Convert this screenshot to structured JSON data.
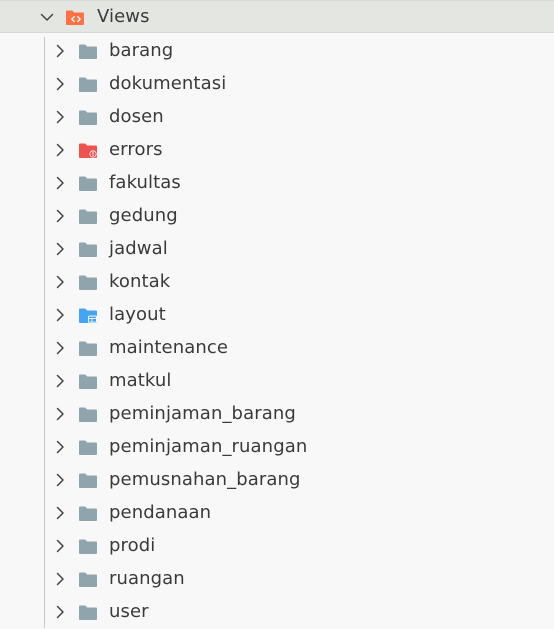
{
  "explorer": {
    "root": {
      "label": "Views",
      "icon": "views-folder-icon",
      "expanded": true
    },
    "children": [
      {
        "label": "barang",
        "icon": "folder-icon"
      },
      {
        "label": "dokumentasi",
        "icon": "folder-icon"
      },
      {
        "label": "dosen",
        "icon": "folder-icon"
      },
      {
        "label": "errors",
        "icon": "errors-folder-icon"
      },
      {
        "label": "fakultas",
        "icon": "folder-icon"
      },
      {
        "label": "gedung",
        "icon": "folder-icon"
      },
      {
        "label": "jadwal",
        "icon": "folder-icon"
      },
      {
        "label": "kontak",
        "icon": "folder-icon"
      },
      {
        "label": "layout",
        "icon": "layout-folder-icon"
      },
      {
        "label": "maintenance",
        "icon": "folder-icon"
      },
      {
        "label": "matkul",
        "icon": "folder-icon"
      },
      {
        "label": "peminjaman_barang",
        "icon": "folder-icon"
      },
      {
        "label": "peminjaman_ruangan",
        "icon": "folder-icon"
      },
      {
        "label": "pemusnahan_barang",
        "icon": "folder-icon"
      },
      {
        "label": "pendanaan",
        "icon": "folder-icon"
      },
      {
        "label": "prodi",
        "icon": "folder-icon"
      },
      {
        "label": "ruangan",
        "icon": "folder-icon"
      },
      {
        "label": "user",
        "icon": "folder-icon"
      }
    ]
  },
  "colors": {
    "folder": "#90a4ae",
    "views_folder": "#ff7043",
    "errors_folder": "#ef5350",
    "layout_folder": "#42a5f5",
    "text": "#3a3a3a",
    "root_background": "#e4e6e1"
  }
}
